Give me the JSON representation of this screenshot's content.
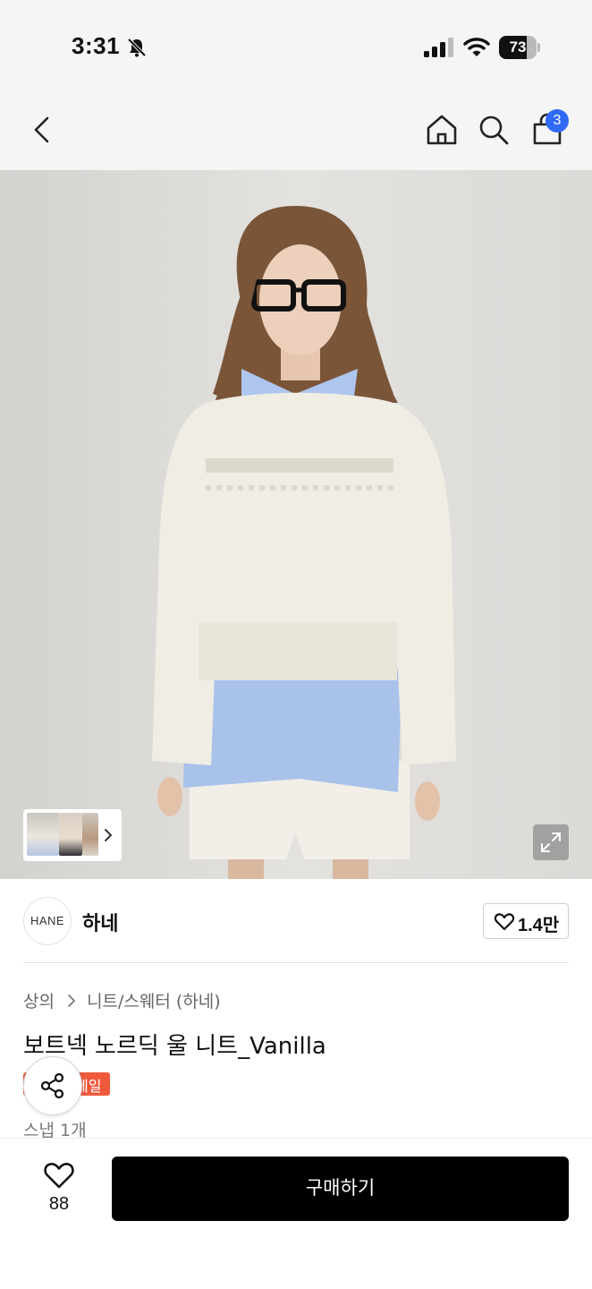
{
  "status_bar": {
    "time": "3:31",
    "battery": "73",
    "battery_level": 0.73
  },
  "nav": {
    "cart_badge": "3"
  },
  "brand": {
    "logo_text": "HANE",
    "name": "하네",
    "likes": "1.4만"
  },
  "product": {
    "breadcrumb": [
      "상의",
      "니트/스웨터 (하네)"
    ],
    "title": "보트넥 노르딕 울 니트_Vanilla",
    "sale_label": "세일",
    "stock_text": "스냅 1개"
  },
  "bottom_bar": {
    "wish_count": "88",
    "buy_label": "구매하기"
  },
  "icons": {
    "back": "back-chevron-icon",
    "home": "home-icon",
    "search": "search-icon",
    "cart": "shopping-bag-icon",
    "share": "share-icon",
    "heart": "heart-icon",
    "expand": "expand-icon"
  },
  "colors": {
    "cart_badge": "#2f6bf6",
    "sale_badge": "#ef5a3c",
    "buy_button": "#000000"
  }
}
